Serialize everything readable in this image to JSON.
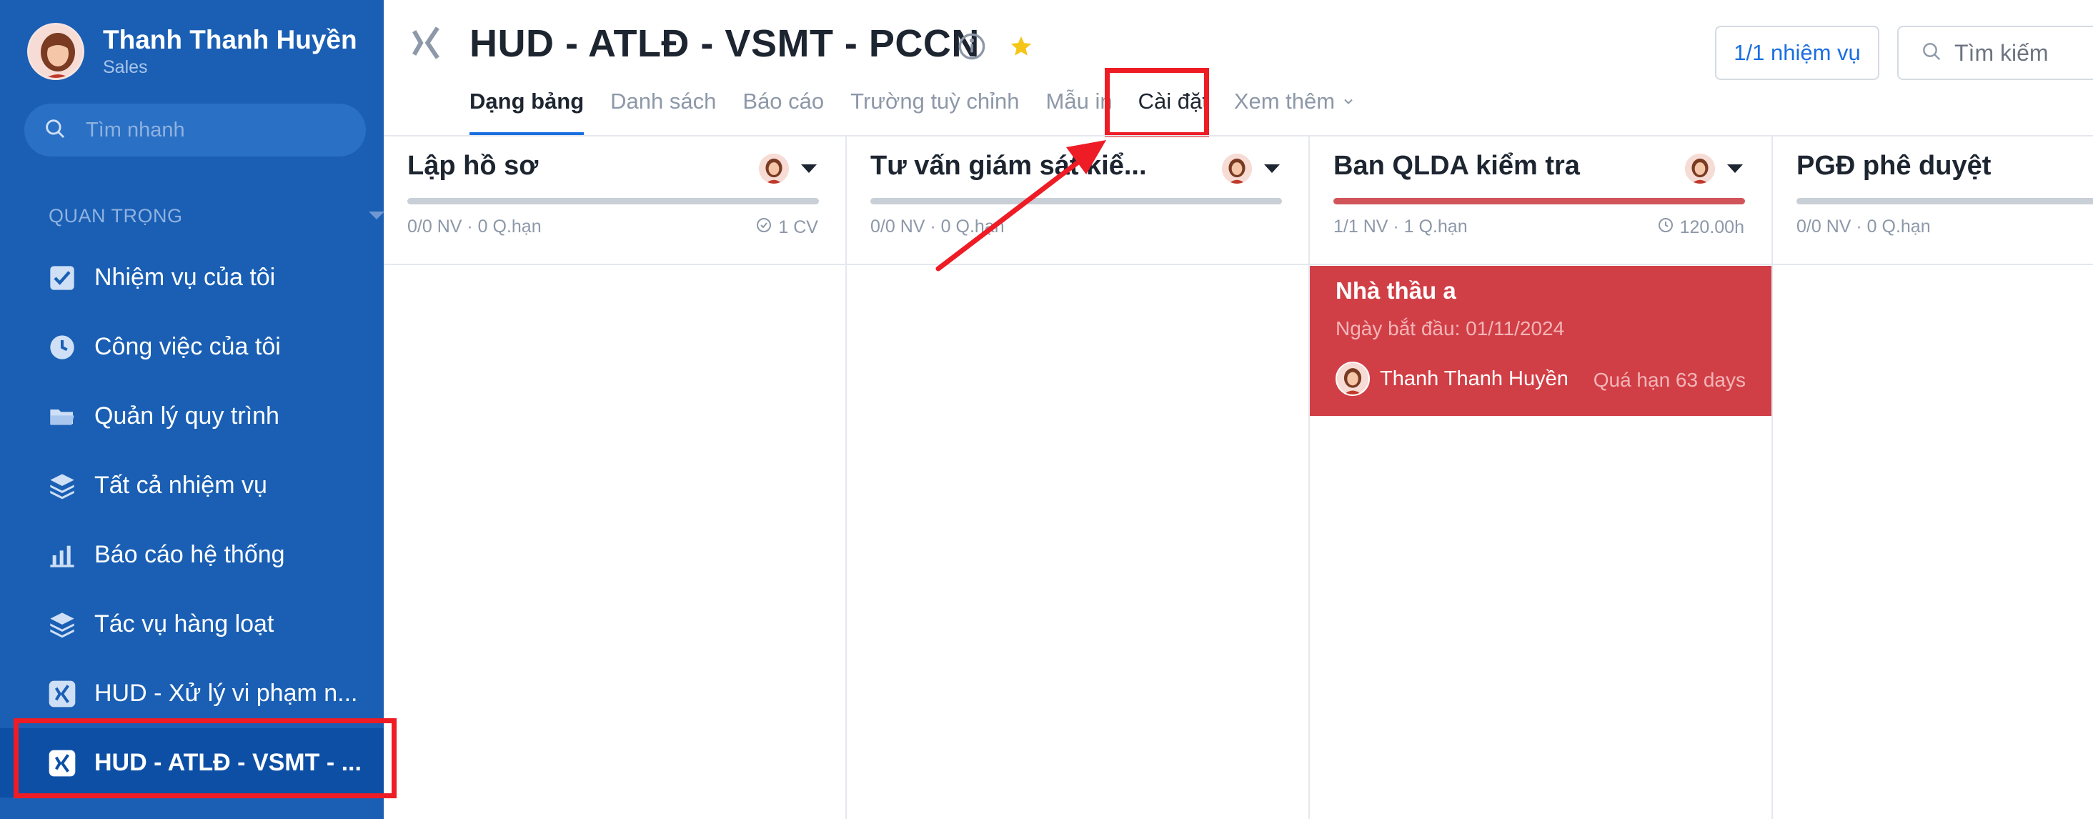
{
  "sidebar": {
    "user_name": "Thanh Thanh Huyền",
    "user_role": "Sales",
    "search_placeholder": "Tìm nhanh",
    "section_label": "QUAN TRỌNG",
    "items": [
      {
        "label": "Nhiệm vụ của tôi",
        "icon": "checkbox-icon"
      },
      {
        "label": "Công việc của tôi",
        "icon": "clock-icon"
      },
      {
        "label": "Quản lý quy trình",
        "icon": "folder-icon"
      },
      {
        "label": "Tất cả nhiệm vụ",
        "icon": "layers-icon"
      },
      {
        "label": "Báo cáo hệ thống",
        "icon": "bar-chart-icon"
      },
      {
        "label": "Tác vụ hàng loạt",
        "icon": "layers-icon"
      },
      {
        "label": "HUD - Xử lý vi phạm n...",
        "icon": "xing-icon"
      },
      {
        "label": "HUD - ATLĐ - VSMT - ...",
        "icon": "xing-icon"
      }
    ]
  },
  "header": {
    "title": "HUD - ATLĐ - VSMT - PCCN",
    "tabs": [
      "Dạng bảng",
      "Danh sách",
      "Báo cáo",
      "Trường tuỳ chỉnh",
      "Mẫu in",
      "Cài đặt",
      "Xem thêm"
    ],
    "tasks_button": "1/1 nhiệm vụ",
    "search_placeholder": "Tìm kiếm"
  },
  "columns": [
    {
      "title": "Lập hồ sơ",
      "stats": "0/0 NV · 0 Q.hạn",
      "right": "1 CV",
      "right_icon": "check-circle-icon",
      "bar_color": "#c9cfd6"
    },
    {
      "title": "Tư vấn giám sát kiể...",
      "stats": "0/0 NV · 0 Q.hạn",
      "right": "",
      "bar_color": "#c9cfd6"
    },
    {
      "title": "Ban QLDA kiểm tra",
      "stats": "1/1 NV · 1 Q.hạn",
      "right": "120.00h",
      "right_icon": "clock-icon",
      "bar_color": "#d1545b"
    },
    {
      "title": "PGĐ phê duyệt",
      "stats": "0/0 NV · 0 Q.hạn",
      "right": "",
      "bar_color": "#c9cfd6"
    }
  ],
  "card": {
    "title": "Nhà thầu a",
    "start_date": "Ngày bắt đầu: 01/11/2024",
    "user": "Thanh Thanh Huyền",
    "overdue": "Quá hạn 63 days"
  },
  "colors": {
    "sidebar_bg": "#1a5fb4",
    "accent": "#1a6ee0",
    "card_overdue": "#d13f46",
    "highlight": "#ee1c25",
    "star": "#f5c518"
  }
}
